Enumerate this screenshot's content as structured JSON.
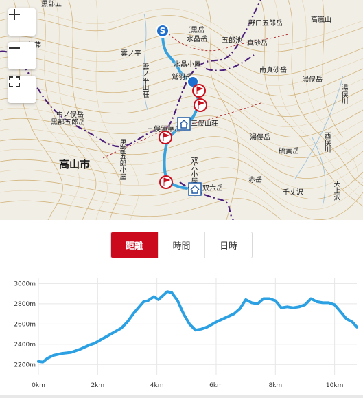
{
  "map": {
    "controls": {
      "zoom_in": "+",
      "zoom_out": "−",
      "fullscreen": "fullscreen"
    },
    "labels": {
      "kurobe_goro_koya_top": "黒部五",
      "kuro_dake": "（黒岳",
      "suisho_dake": "水晶岳",
      "noguchi_goro": "野口五郎岳",
      "takase_yama": "高嵐山",
      "goro_ike": "五郎池",
      "masago_dake": "真砂岳",
      "kumo_no_taira": "雲ノ平",
      "kumo_no_taira_sanso": "雲ノ平山荘",
      "suisho_koya": "水晶小屋",
      "washiba": "鷲羽岳",
      "minami_masago": "南真砂岳",
      "yubata_dake": "湯俣岳",
      "yumata_kawa": "湯俣川",
      "naka_no_mata": "中ノ俣岳",
      "kurobe_goro_dake": "黒部五郎岳",
      "mitsumata_renge": "三俣蓮華岳",
      "mitsumata_sanso": "三俣山荘",
      "kurobe_goro_koya": "黒部五郎小屋",
      "yumata_dake2": "湯俣岳",
      "iou_dake": "硫黄岳",
      "futamata": "西俣川",
      "takayama_city": "高山市",
      "sugoroku": "双六小屋",
      "sugoroku_dake": "双六岳",
      "aka_dake": "赤岳",
      "sendan": "千丈沢",
      "tenjo": "天上沢",
      "hida": "伊藤",
      "start": "S"
    },
    "colors": {
      "route": "#2299dd",
      "boundary": "#4b1e7a",
      "contour": "#c9a25a",
      "start_marker": "#1f6fd1",
      "flag_marker": "#c9101e"
    }
  },
  "tabs": [
    {
      "label": "距離",
      "active": true
    },
    {
      "label": "時間",
      "active": false
    },
    {
      "label": "日時",
      "active": false
    }
  ],
  "chart_data": {
    "type": "area",
    "title": "",
    "xlabel": "",
    "ylabel": "",
    "x_unit": "km",
    "y_unit": "m",
    "x_ticks": [
      "0km",
      "2km",
      "4km",
      "6km",
      "8km",
      "10km"
    ],
    "y_ticks": [
      "2200m",
      "2400m",
      "2600m",
      "2800m",
      "3000m"
    ],
    "xlim": [
      0,
      10.75
    ],
    "ylim": [
      2100,
      3050
    ],
    "color": "#2ba0e2",
    "x": [
      0.0,
      0.15,
      0.3,
      0.5,
      0.8,
      1.1,
      1.4,
      1.7,
      1.9,
      2.2,
      2.5,
      2.8,
      3.0,
      3.2,
      3.4,
      3.55,
      3.7,
      3.9,
      4.05,
      4.2,
      4.35,
      4.5,
      4.7,
      4.9,
      5.1,
      5.3,
      5.5,
      5.7,
      6.0,
      6.3,
      6.6,
      6.8,
      7.0,
      7.2,
      7.4,
      7.6,
      7.8,
      8.0,
      8.2,
      8.4,
      8.6,
      8.8,
      9.0,
      9.2,
      9.4,
      9.6,
      9.8,
      10.0,
      10.2,
      10.4,
      10.6,
      10.75
    ],
    "y": [
      2230,
      2225,
      2260,
      2290,
      2310,
      2320,
      2350,
      2390,
      2410,
      2460,
      2510,
      2560,
      2620,
      2700,
      2770,
      2820,
      2830,
      2870,
      2840,
      2880,
      2920,
      2910,
      2830,
      2700,
      2600,
      2540,
      2550,
      2570,
      2620,
      2660,
      2700,
      2750,
      2840,
      2810,
      2800,
      2850,
      2850,
      2830,
      2760,
      2770,
      2760,
      2770,
      2790,
      2850,
      2820,
      2810,
      2810,
      2790,
      2720,
      2650,
      2620,
      2570
    ]
  }
}
